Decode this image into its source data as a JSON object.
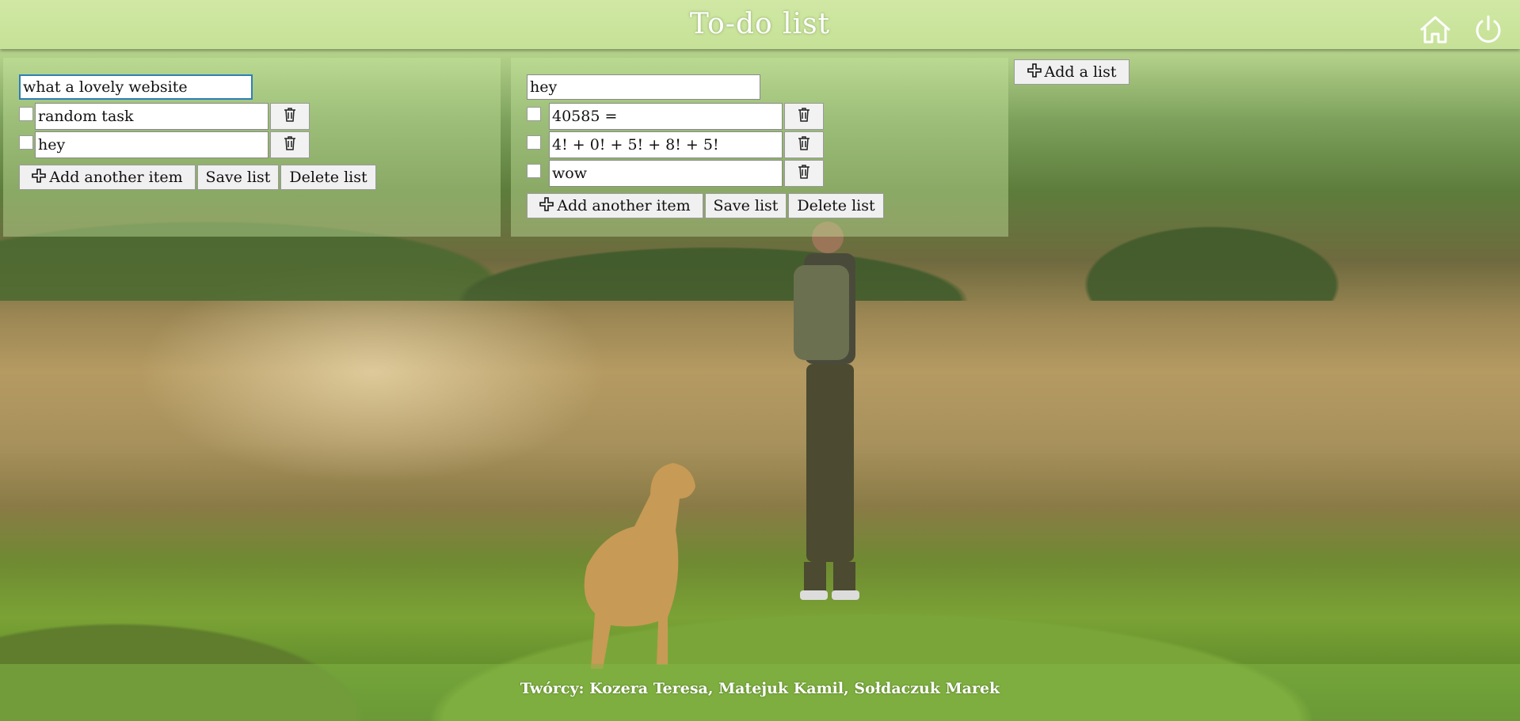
{
  "header": {
    "title": "To-do list",
    "home_icon": "home-icon",
    "power_icon": "power-icon"
  },
  "add_list_button": {
    "label": "Add a list",
    "icon": "plus-icon"
  },
  "lists": [
    {
      "title": "what a lovely website",
      "items": [
        {
          "text": "random task",
          "checked": false
        },
        {
          "text": "hey",
          "checked": false
        }
      ],
      "add_item_label": "Add another item",
      "save_label": "Save list",
      "delete_label": "Delete list"
    },
    {
      "title": "hey",
      "items": [
        {
          "text": "40585 =",
          "checked": false
        },
        {
          "text": "4! + 0! + 5! + 8! + 5!",
          "checked": false
        },
        {
          "text": "wow",
          "checked": false
        }
      ],
      "add_item_label": "Add another item",
      "save_label": "Save list",
      "delete_label": "Delete list"
    }
  ],
  "footer": {
    "credits": "Twórcy: Kozera Teresa, Matejuk Kamil, Sołdaczuk Marek"
  },
  "colors": {
    "focus_border": "#2e7fb8",
    "header_text": "#ffffff"
  }
}
